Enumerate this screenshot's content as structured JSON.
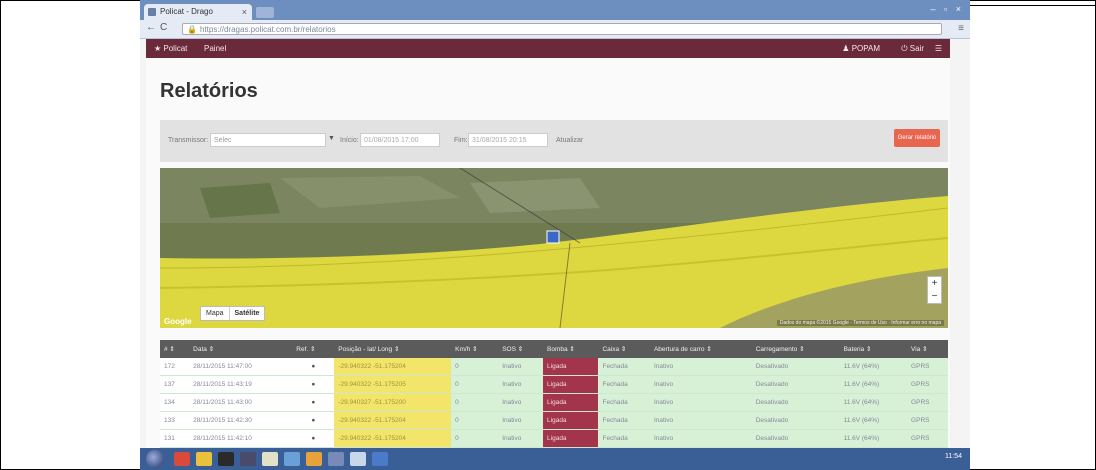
{
  "browser": {
    "tab_title": "Policat - Drago",
    "url": "https://dragas.policat.com.br/relatorios",
    "lock_icon": "lock-icon",
    "window_controls": "– ▫ ×"
  },
  "app": {
    "brand": "★ Policat",
    "nav_painel": "Painel",
    "user_label": "♟ POPAM",
    "logout_label": "⏻ Sair",
    "menu_icon": "hamburger-icon"
  },
  "page": {
    "title": "Relatórios"
  },
  "filters": {
    "transmissor_label": "Transmissor:",
    "transmissor_value": "Selec",
    "inicio_label": "Início:",
    "inicio_value": "01/08/2015 17:00",
    "fim_label": "Fim:",
    "fim_value": "31/08/2015 20:15",
    "extra_label": "Atualizar",
    "action_label": "Gerar relatório"
  },
  "map": {
    "toggle_mapa": "Mapa",
    "toggle_satelite": "Satélite",
    "zoom_in": "+",
    "zoom_out": "−",
    "attribution": "Dados do mapa ©2015 Google · Termos de Uso · Informar erro no mapa",
    "logo": "Google",
    "colors": {
      "overlay": "#e8e23a",
      "water": "#5a7a6a",
      "land": "#6b7a4a"
    }
  },
  "table": {
    "headers": [
      "# ⇕",
      "Data ⇕",
      "Ref. ⇕",
      "Posição - lat/ Long ⇕",
      "Km/h ⇕",
      "SOS ⇕",
      "Bomba ⇕",
      "Caixa ⇕",
      "Abertura de carro ⇕",
      "Carregamento ⇕",
      "Bateria ⇕",
      "Via ⇕"
    ],
    "rows": [
      [
        "172",
        "28/11/2015 11:47:00",
        "●",
        "-29.940322 -51.175204",
        "0",
        "Inativo",
        "Ligada",
        "Fechada",
        "Inativo",
        "Desativado",
        "11.6V (64%)",
        "GPRS"
      ],
      [
        "137",
        "28/11/2015 11:43:19",
        "●",
        "-29.940322 -51.175205",
        "0",
        "Inativo",
        "Ligada",
        "Fechada",
        "Inativo",
        "Desativado",
        "11.6V (64%)",
        "GPRS"
      ],
      [
        "134",
        "28/11/2015 11:43:00",
        "●",
        "-29.940327 -51.175200",
        "0",
        "Inativo",
        "Ligada",
        "Fechada",
        "Inativo",
        "Desativado",
        "11.6V (64%)",
        "GPRS"
      ],
      [
        "133",
        "28/11/2015 11:42:30",
        "●",
        "-29.940322 -51.175204",
        "0",
        "Inativo",
        "Ligada",
        "Fechada",
        "Inativo",
        "Desativado",
        "11.6V (64%)",
        "GPRS"
      ],
      [
        "131",
        "28/11/2015 11:42:10",
        "●",
        "-29.940322 -51.175204",
        "0",
        "Inativo",
        "Ligada",
        "Fechada",
        "Inativo",
        "Desativado",
        "11.6V (64%)",
        "GPRS"
      ]
    ]
  },
  "taskbar": {
    "clock": "11:54"
  }
}
